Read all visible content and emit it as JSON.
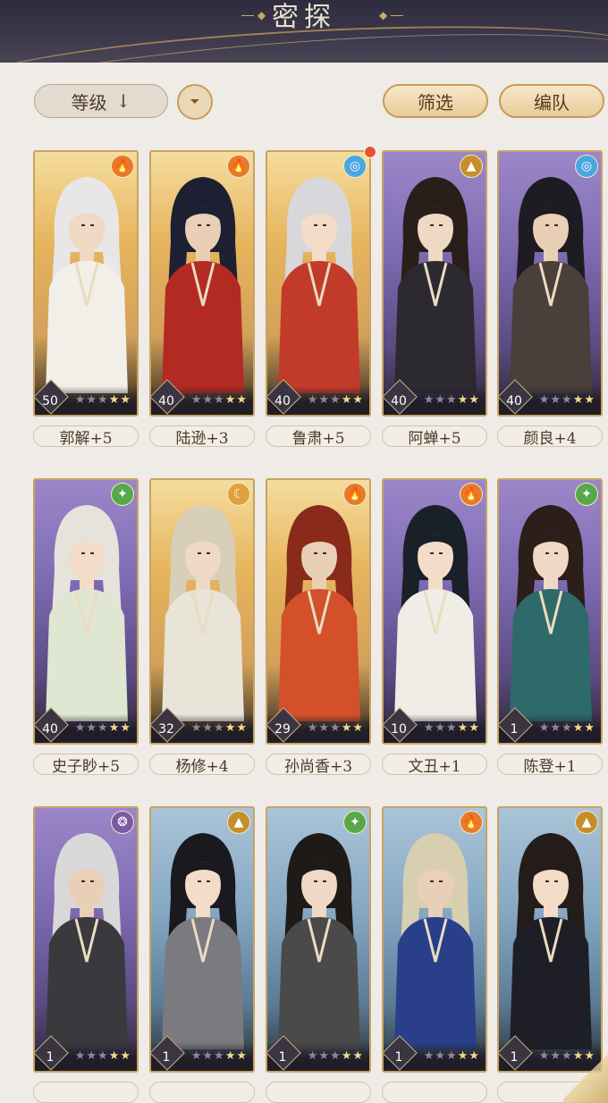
{
  "header": {
    "title": "密探"
  },
  "toolbar": {
    "sort_label": "等级",
    "sort_arrow": "↓",
    "filter_label": "筛选",
    "team_label": "编队"
  },
  "colors": {
    "gold_frame": "#c7a364",
    "purple_frame": "#7d69b0",
    "blue_frame": "#86a7c2",
    "accent": "#c89a58"
  },
  "cards": [
    {
      "name": "郭解+5",
      "level": "50",
      "element": "fire",
      "frame": "gold",
      "stars_lit": 2,
      "stars_total": 5
    },
    {
      "name": "陆逊+3",
      "level": "40",
      "element": "fire",
      "frame": "gold",
      "stars_lit": 2,
      "stars_total": 5
    },
    {
      "name": "鲁肃+5",
      "level": "40",
      "element": "water",
      "frame": "gold",
      "stars_lit": 2,
      "stars_total": 5
    },
    {
      "name": "阿蝉+5",
      "level": "40",
      "element": "earth",
      "frame": "purple",
      "stars_lit": 2,
      "stars_total": 5
    },
    {
      "name": "颜良+4",
      "level": "40",
      "element": "water",
      "frame": "purple",
      "stars_lit": 2,
      "stars_total": 5
    },
    {
      "name": "史子眇+5",
      "level": "40",
      "element": "wind",
      "frame": "purple",
      "stars_lit": 2,
      "stars_total": 5
    },
    {
      "name": "杨修+4",
      "level": "32",
      "element": "moon",
      "frame": "gold",
      "stars_lit": 2,
      "stars_total": 5
    },
    {
      "name": "孙尚香+3",
      "level": "29",
      "element": "fire",
      "frame": "gold",
      "stars_lit": 2,
      "stars_total": 5
    },
    {
      "name": "文丑+1",
      "level": "10",
      "element": "fire",
      "frame": "purple",
      "stars_lit": 2,
      "stars_total": 5
    },
    {
      "name": "陈登+1",
      "level": "1",
      "element": "wind",
      "frame": "purple",
      "stars_lit": 2,
      "stars_total": 5
    },
    {
      "name": "",
      "level": "1",
      "element": "dark",
      "frame": "purple",
      "stars_lit": 2,
      "stars_total": 5
    },
    {
      "name": "",
      "level": "1",
      "element": "earth",
      "frame": "blue",
      "stars_lit": 2,
      "stars_total": 5
    },
    {
      "name": "",
      "level": "1",
      "element": "wind",
      "frame": "blue",
      "stars_lit": 2,
      "stars_total": 5
    },
    {
      "name": "",
      "level": "1",
      "element": "fire",
      "frame": "blue",
      "stars_lit": 2,
      "stars_total": 5
    },
    {
      "name": "",
      "level": "1",
      "element": "earth",
      "frame": "blue",
      "stars_lit": 2,
      "stars_total": 5
    }
  ],
  "icons": {
    "fire": "🔥",
    "water": "◎",
    "earth": "▲",
    "wind": "✦",
    "moon": "☾",
    "dark": "❂"
  }
}
